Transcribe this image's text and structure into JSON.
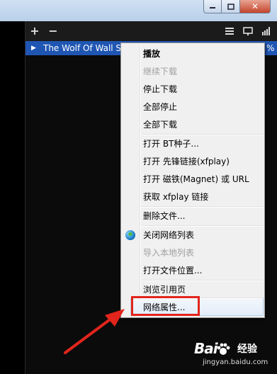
{
  "window": {
    "controls": {
      "minimize_icon": "minimize-icon",
      "maximize_icon": "maximize-icon",
      "close_label": "✕"
    }
  },
  "toolbar": {
    "icons": [
      "add-icon",
      "remove-icon",
      "list-icon",
      "screen-icon",
      "signal-bars-icon"
    ],
    "add_label": "+",
    "remove_label": "−"
  },
  "download_list": {
    "rows": [
      {
        "title": "The Wolf Of Wall S",
        "percent_suffix": "%",
        "expand_arrow": "▶"
      }
    ]
  },
  "context_menu": {
    "items": [
      {
        "label": "播放",
        "enabled": true,
        "bold": true
      },
      {
        "label": "继续下载",
        "enabled": false
      },
      {
        "label": "停止下载",
        "enabled": true
      },
      {
        "label": "全部停止",
        "enabled": true
      },
      {
        "label": "全部下载",
        "enabled": true
      },
      {
        "label": "打开 BT种子...",
        "enabled": true
      },
      {
        "label": "打开 先锋链接(xfplay)",
        "enabled": true
      },
      {
        "label": "打开 磁铁(Magnet) 或 URL",
        "enabled": true
      },
      {
        "label": "获取 xfplay 链接",
        "enabled": true
      },
      {
        "label": "删除文件...",
        "enabled": true
      },
      {
        "label": "关闭网络列表",
        "enabled": true,
        "icon": "globe-icon"
      },
      {
        "label": "导入本地列表",
        "enabled": false
      },
      {
        "label": "打开文件位置...",
        "enabled": true
      },
      {
        "label": "浏览引用页",
        "enabled": true
      },
      {
        "label": "网络属性...",
        "enabled": true,
        "hovered": true
      }
    ]
  },
  "annotation": {
    "highlight_color": "#e2251c"
  },
  "watermark": {
    "logo": "Bai",
    "brand_suffix": "经验",
    "url": "jingyan.baidu.com"
  },
  "colors": {
    "selection": "#1f56b3",
    "menu_bg": "#f0f0f0",
    "disabled_text": "#a0a0a0"
  }
}
